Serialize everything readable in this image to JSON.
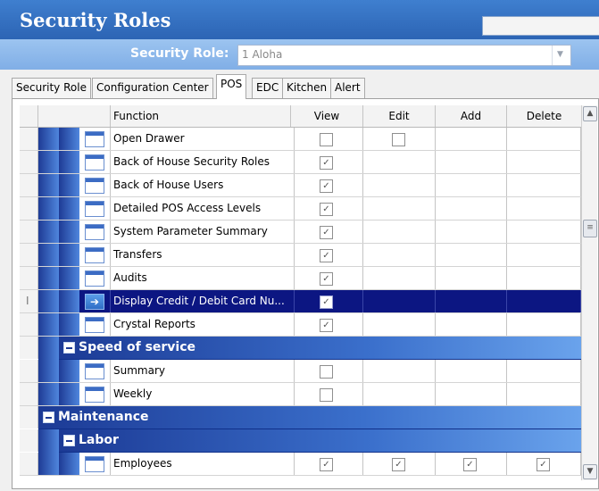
{
  "window": {
    "title": "Security Roles"
  },
  "role": {
    "label": "Security Role:",
    "value": "1 Aloha"
  },
  "tabs": [
    "Security Role",
    "Configuration Center",
    "POS",
    "EDC",
    "Kitchen",
    "Alert"
  ],
  "active_tab": "POS",
  "columns": {
    "function": "Function",
    "view": "View",
    "edit": "Edit",
    "add": "Add",
    "delete": "Delete"
  },
  "rows": [
    {
      "label": "Open Drawer",
      "view": false,
      "edit": false
    },
    {
      "label": "Back of House Security Roles",
      "view": true
    },
    {
      "label": "Back of House Users",
      "view": true
    },
    {
      "label": "Detailed POS Access Levels",
      "view": true
    },
    {
      "label": "System Parameter Summary",
      "view": true
    },
    {
      "label": "Transfers",
      "view": true
    },
    {
      "label": "Audits",
      "view": true
    },
    {
      "label": "Display Credit / Debit Card Nu...",
      "view": true,
      "selected": true
    },
    {
      "label": "Crystal Reports",
      "view": true
    },
    {
      "group": "Speed of service"
    },
    {
      "label": "Summary",
      "view": false
    },
    {
      "label": "Weekly",
      "view": false
    },
    {
      "group": "Maintenance"
    },
    {
      "group": "Labor"
    },
    {
      "label": "Employees",
      "view": true,
      "edit": true,
      "add": true,
      "delete": true
    }
  ],
  "colors": {
    "title_bar": "#2c64b4",
    "group_band": "#1c3a95",
    "selected_row": "#0c1682"
  }
}
